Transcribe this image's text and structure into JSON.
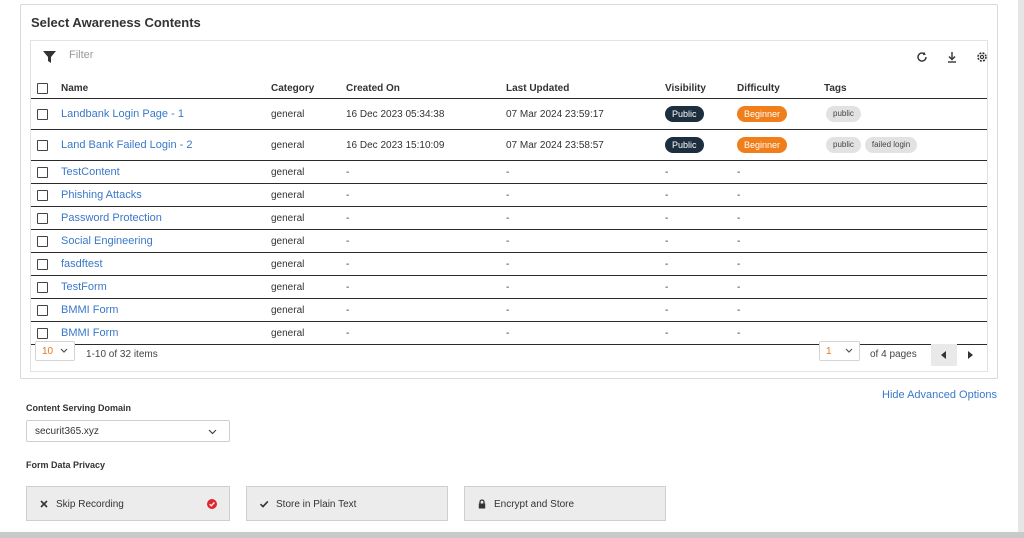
{
  "title": "Select Awareness Contents",
  "filter": {
    "placeholder": "Filter"
  },
  "toolbar_icons": [
    "refresh-icon",
    "download-icon",
    "settings-icon"
  ],
  "columns": {
    "name": "Name",
    "category": "Category",
    "created_on": "Created On",
    "last_updated": "Last Updated",
    "visibility": "Visibility",
    "difficulty": "Difficulty",
    "tags": "Tags"
  },
  "rows": [
    {
      "name": "Landbank Login Page - 1",
      "category": "general",
      "created_on": "16 Dec 2023 05:34:38",
      "last_updated": "07 Mar 2024 23:59:17",
      "visibility": "Public",
      "difficulty": "Beginner",
      "tags": [
        "public"
      ]
    },
    {
      "name": "Land Bank Failed Login - 2",
      "category": "general",
      "created_on": "16 Dec 2023 15:10:09",
      "last_updated": "07 Mar 2024 23:58:57",
      "visibility": "Public",
      "difficulty": "Beginner",
      "tags": [
        "public",
        "failed login"
      ]
    },
    {
      "name": "TestContent",
      "category": "general",
      "created_on": "-",
      "last_updated": "-",
      "visibility": "-",
      "difficulty": "-",
      "tags": []
    },
    {
      "name": "Phishing Attacks",
      "category": "general",
      "created_on": "-",
      "last_updated": "-",
      "visibility": "-",
      "difficulty": "-",
      "tags": []
    },
    {
      "name": "Password Protection",
      "category": "general",
      "created_on": "-",
      "last_updated": "-",
      "visibility": "-",
      "difficulty": "-",
      "tags": []
    },
    {
      "name": "Social Engineering",
      "category": "general",
      "created_on": "-",
      "last_updated": "-",
      "visibility": "-",
      "difficulty": "-",
      "tags": []
    },
    {
      "name": "fasdftest",
      "category": "general",
      "created_on": "-",
      "last_updated": "-",
      "visibility": "-",
      "difficulty": "-",
      "tags": []
    },
    {
      "name": "TestForm",
      "category": "general",
      "created_on": "-",
      "last_updated": "-",
      "visibility": "-",
      "difficulty": "-",
      "tags": []
    },
    {
      "name": "BMMI Form",
      "category": "general",
      "created_on": "-",
      "last_updated": "-",
      "visibility": "-",
      "difficulty": "-",
      "tags": []
    },
    {
      "name": "BMMI Form",
      "category": "general",
      "created_on": "-",
      "last_updated": "-",
      "visibility": "-",
      "difficulty": "-",
      "tags": []
    }
  ],
  "pagination": {
    "page_size": "10",
    "range_text": "1-10 of 32 items",
    "current_page": "1",
    "pages_text": "of 4 pages"
  },
  "advanced": {
    "hide_label": "Hide Advanced Options"
  },
  "serving_domain": {
    "label": "Content Serving Domain",
    "value": "securit365.xyz"
  },
  "privacy": {
    "label": "Form Data Privacy",
    "options": [
      {
        "label": "Skip Recording",
        "icon": "x-icon",
        "selected": true
      },
      {
        "label": "Store in Plain Text",
        "icon": "check-icon",
        "selected": false
      },
      {
        "label": "Encrypt and Store",
        "icon": "lock-icon",
        "selected": false
      }
    ]
  },
  "colors": {
    "link": "#3a78c9",
    "visibility_pill": "#1d2f3f",
    "difficulty_pill": "#f07f1b",
    "selected_badge": "#e0262f"
  }
}
